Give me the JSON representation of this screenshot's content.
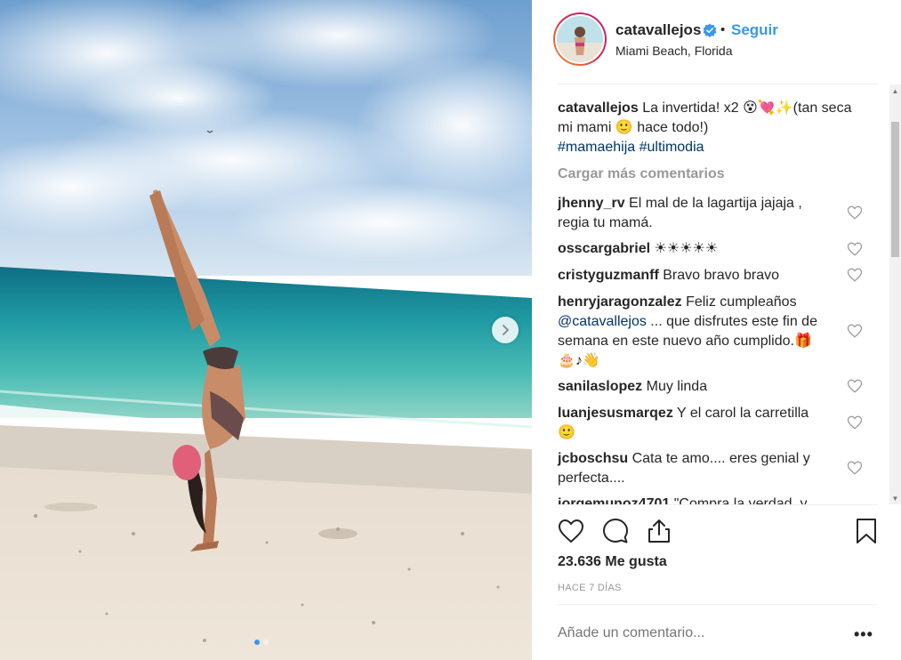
{
  "post": {
    "username": "catavallejos",
    "follow_label": "Seguir",
    "separator": "•",
    "location": "Miami Beach, Florida",
    "caption": {
      "username": "catavallejos",
      "text": "La invertida! x2 😵💘✨(tan seca mi mami 🙂 hace todo!)",
      "hashtags": "#mamaehija #ultimodia"
    },
    "load_more_label": "Cargar más comentarios",
    "comments": [
      {
        "username": "jhenny_rv",
        "text": "El mal de la lagartija jajaja , regia tu mamá."
      },
      {
        "username": "osscargabriel",
        "text": "☀☀☀☀☀"
      },
      {
        "username": "cristyguzmanff",
        "text": "Bravo bravo bravo"
      },
      {
        "username": "henryjaragonzalez",
        "text_before": "Feliz cumpleaños",
        "mention": "@catavallejos",
        "text_after": "... que disfrutes este fin de semana en este nuevo año cumplido.🎁🎂♪👋"
      },
      {
        "username": "sanilaslopez",
        "text": "Muy linda"
      },
      {
        "username": "luanjesusmarqez",
        "text": "Y el carol la carretilla 🙂"
      },
      {
        "username": "jcboschsu",
        "text": "Cata te amo.... eres genial y perfecta...."
      },
      {
        "username": "jorgemunoz4701",
        "text": "\"Compra la verdad, y"
      }
    ],
    "likes": "23.636 Me gusta",
    "time_ago": "HACE 7 DÍAS",
    "add_comment_placeholder": "Añade un comentario...",
    "more_options": "•••",
    "icons": {
      "verified": "verified-badge-icon",
      "like": "heart-icon",
      "comment": "comment-bubble-icon",
      "share": "share-icon",
      "save": "bookmark-icon",
      "next": "chevron-right-icon"
    },
    "colors": {
      "link_blue": "#3897f0",
      "hashtag_blue": "#003569",
      "muted": "#999999"
    },
    "carousel": {
      "total": 2,
      "active": 1
    }
  }
}
